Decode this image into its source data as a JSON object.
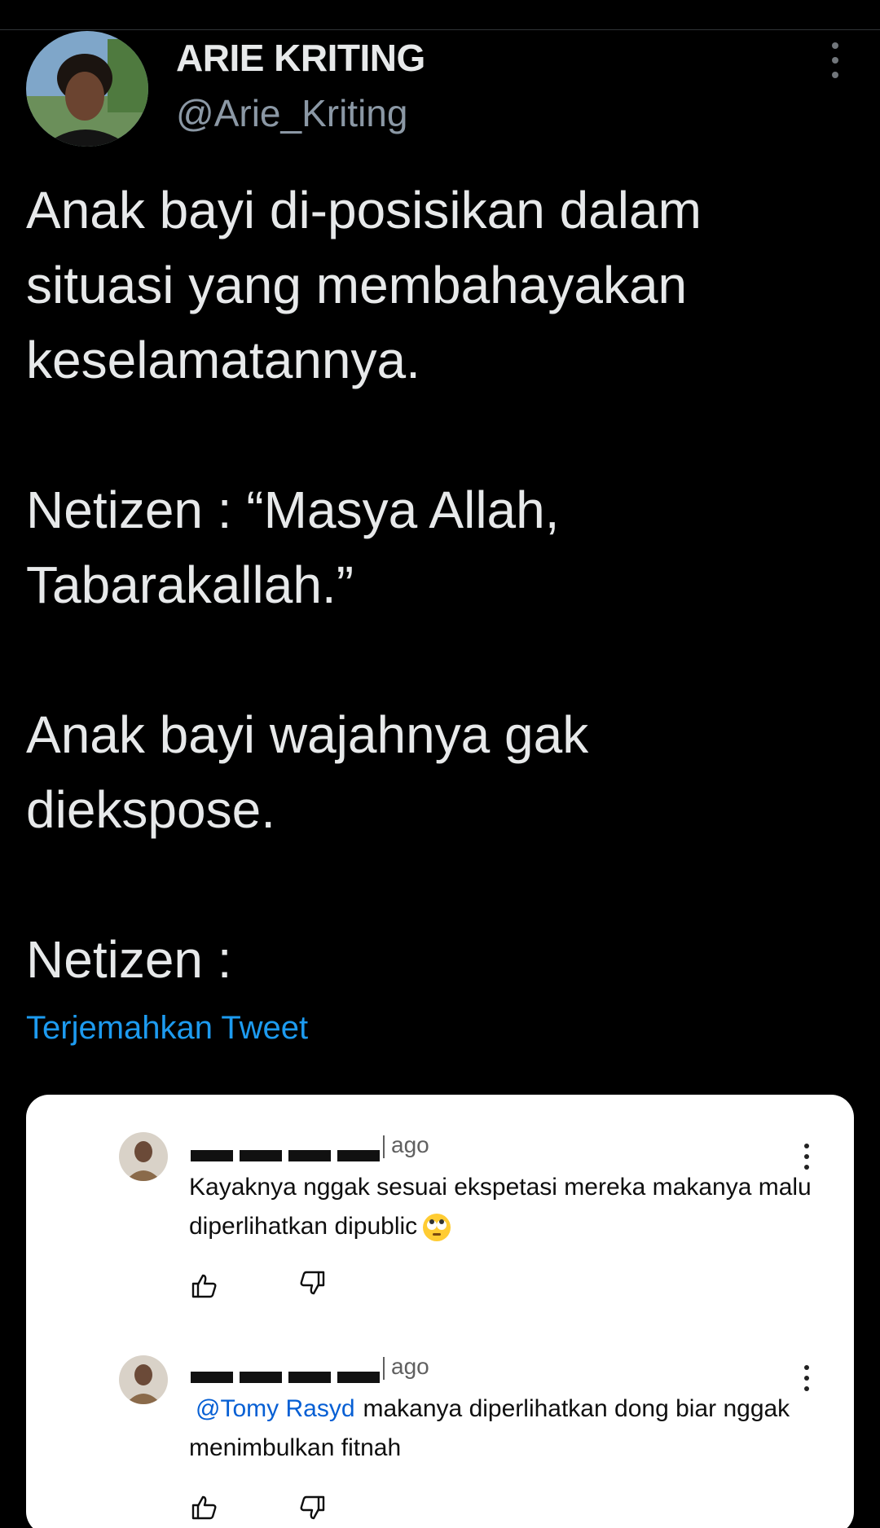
{
  "tweet": {
    "display_name": "ARIE KRITING",
    "handle": "@Arie_Kriting",
    "text": "Anak bayi di-posisikan dalam\nsituasi yang membahayakan\nkeselamatannya.\n\nNetizen : “Masya Allah,\nTabarakallah.”\n\nAnak bayi wajahnya gak\ndiekspose.\n\nNetizen :",
    "translate_link": "Terjemahkan Tweet",
    "more_icon": "more-vertical-icon"
  },
  "media": {
    "comments": [
      {
        "ago": "ago",
        "text": "Kayaknya nggak sesuai ekspetasi mereka makanya malu diperlihatkan dipublic",
        "emoji": "rolling-eyes-emoji",
        "like_icon": "thumbs-up-icon",
        "dislike_icon": "thumbs-down-icon"
      },
      {
        "ago": "ago",
        "mention": "@Tomy Rasyd",
        "text": "makanya diperlihatkan dong biar nggak menimbulkan fitnah",
        "like_icon": "thumbs-up-icon",
        "dislike_icon": "thumbs-down-icon"
      }
    ]
  },
  "colors": {
    "background": "#000000",
    "text": "#e7e9ea",
    "secondary": "#8b98a5",
    "link": "#1d9bf0",
    "mention": "#065fd4"
  }
}
